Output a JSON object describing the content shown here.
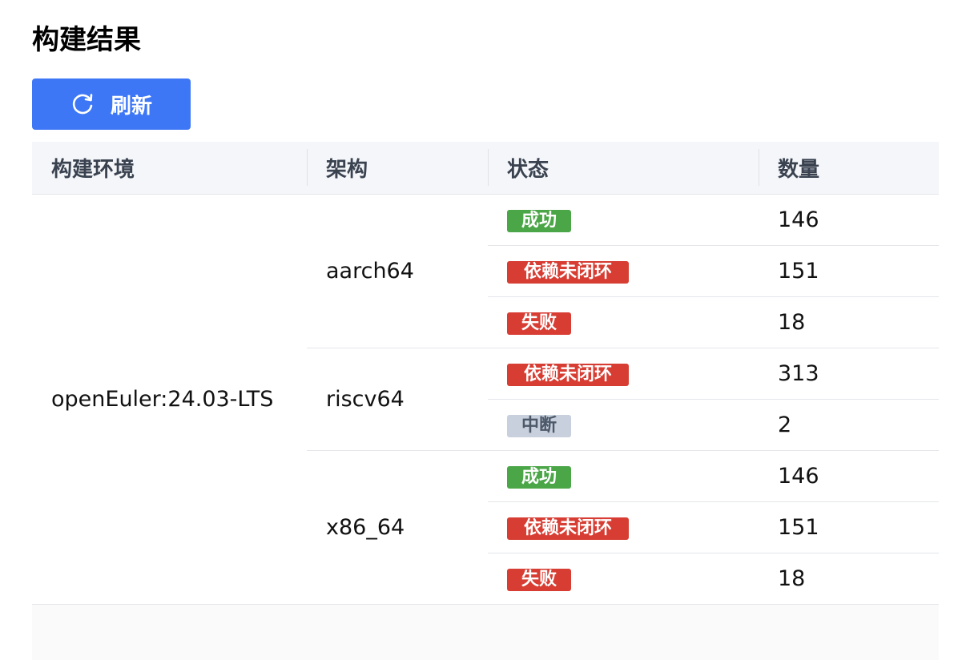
{
  "page": {
    "title": "构建结果"
  },
  "toolbar": {
    "refresh_label": "刷新",
    "refresh_icon": "refresh-icon"
  },
  "colors": {
    "primary": "#3d77f6",
    "success": "#4aa647",
    "danger": "#d73d33",
    "neutral": "#c7d0dc"
  },
  "table": {
    "headers": [
      "构建环境",
      "架构",
      "状态",
      "数量"
    ],
    "environment": "openEuler:24.03-LTS",
    "groups": [
      {
        "arch": "aarch64",
        "rows": [
          {
            "status": "成功",
            "kind": "success",
            "count": "146"
          },
          {
            "status": "依赖未闭环",
            "kind": "unclosed",
            "count": "151"
          },
          {
            "status": "失败",
            "kind": "fail",
            "count": "18"
          }
        ]
      },
      {
        "arch": "riscv64",
        "rows": [
          {
            "status": "依赖未闭环",
            "kind": "unclosed",
            "count": "313"
          },
          {
            "status": "中断",
            "kind": "interrupt",
            "count": "2"
          }
        ]
      },
      {
        "arch": "x86_64",
        "rows": [
          {
            "status": "成功",
            "kind": "success",
            "count": "146"
          },
          {
            "status": "依赖未闭环",
            "kind": "unclosed",
            "count": "151"
          },
          {
            "status": "失败",
            "kind": "fail",
            "count": "18"
          }
        ]
      }
    ]
  }
}
